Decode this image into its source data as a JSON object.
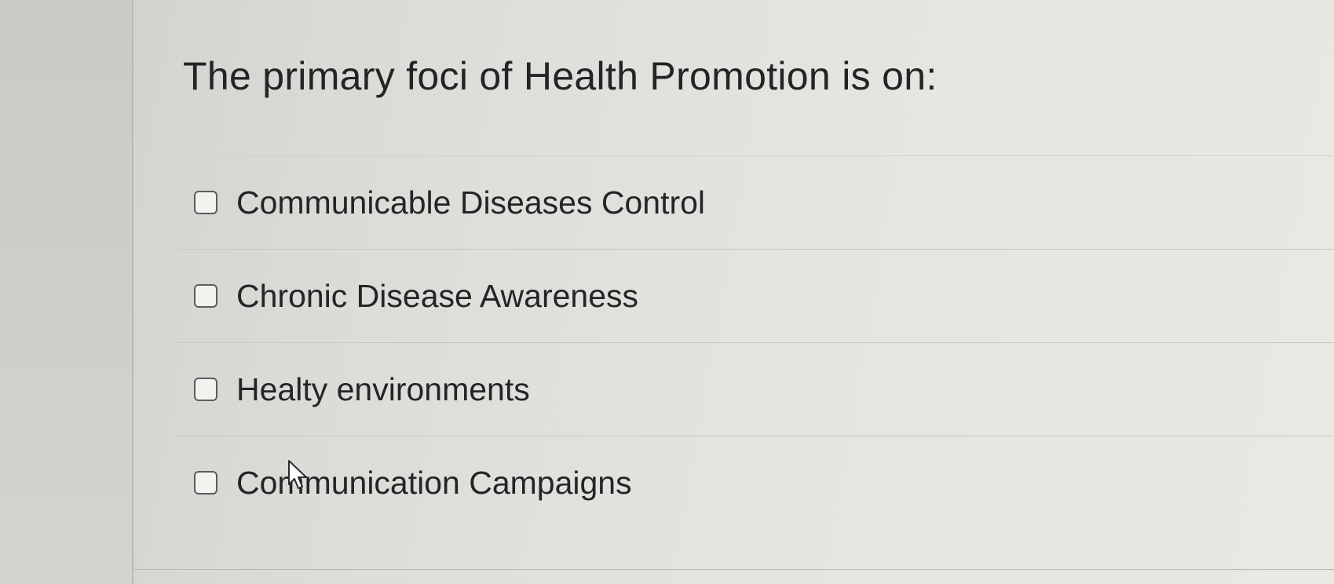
{
  "question": {
    "text": "The primary foci of Health Promotion is on:"
  },
  "choices": [
    {
      "label": "Communicable Diseases Control",
      "checked": false
    },
    {
      "label": "Chronic Disease Awareness",
      "checked": false
    },
    {
      "label": "Healty environments",
      "checked": false
    },
    {
      "label": "Communication Campaigns",
      "checked": false
    }
  ],
  "icons": {
    "checkbox": "checkbox-unchecked-icon",
    "cursor": "mouse-pointer-icon"
  },
  "colors": {
    "text": "#232527",
    "checkbox_border": "#5a5d60",
    "background": "#e4e5e0"
  }
}
